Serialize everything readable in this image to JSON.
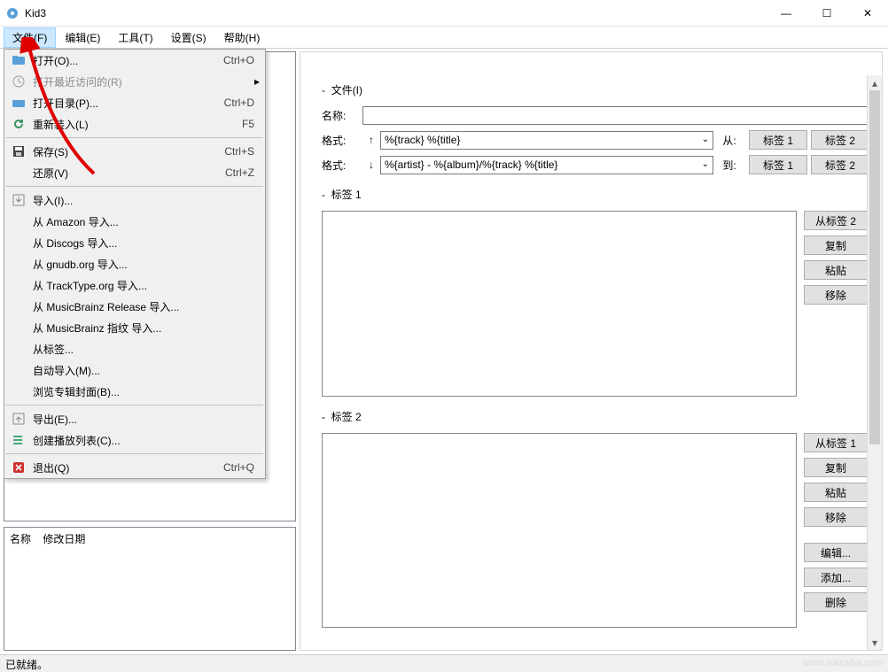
{
  "window": {
    "title": "Kid3",
    "minimize": "—",
    "maximize": "☐",
    "close": "✕"
  },
  "menubar": {
    "file": "文件(F)",
    "edit": "编辑(E)",
    "tools": "工具(T)",
    "settings": "设置(S)",
    "help": "帮助(H)"
  },
  "file_menu": {
    "open": "打开(O)...",
    "open_sc": "Ctrl+O",
    "open_recent": "打开最近访问的(R)",
    "open_dir": "打开目录(P)...",
    "open_dir_sc": "Ctrl+D",
    "reload": "重新装入(L)",
    "reload_sc": "F5",
    "save": "保存(S)",
    "save_sc": "Ctrl+S",
    "restore": "还原(V)",
    "restore_sc": "Ctrl+Z",
    "import": "导入(I)...",
    "import_amazon": "从 Amazon 导入...",
    "import_discogs": "从 Discogs 导入...",
    "import_gnudb": "从 gnudb.org 导入...",
    "import_tracktype": "从 TrackType.org 导入...",
    "import_mb_release": "从 MusicBrainz Release 导入...",
    "import_mb_fp": "从 MusicBrainz 指纹 导入...",
    "import_tags": "从标签...",
    "auto_import": "自动导入(M)...",
    "browse_cover": "浏览专辑封面(B)...",
    "export": "导出(E)...",
    "create_playlist": "创建播放列表(C)...",
    "quit": "退出(Q)",
    "quit_sc": "Ctrl+Q"
  },
  "filemeta": {
    "name_hdr": "名称",
    "date_hdr": "修改日期"
  },
  "main": {
    "file_section": "文件(I)",
    "name_label": "名称:",
    "format_label1": "格式:",
    "format_label2": "格式:",
    "up_arrow": "↑",
    "down_arrow": "↓",
    "combo1": "%{track} %{title}",
    "combo2": "%{artist} - %{album}/%{track} %{title}",
    "from_label": "从:",
    "to_label": "到:",
    "tag1_btn": "标签 1",
    "tag2_btn": "标签 2",
    "tag1_section": "标签 1",
    "tag2_section": "标签 2",
    "from_tag2": "从标签 2",
    "from_tag1": "从标签 1",
    "copy": "复制",
    "paste": "粘贴",
    "remove": "移除",
    "edit": "编辑...",
    "add": "添加...",
    "delete": "删除"
  },
  "status": {
    "ready": "已就绪。"
  },
  "watermark": "www.xiazaiba.com"
}
